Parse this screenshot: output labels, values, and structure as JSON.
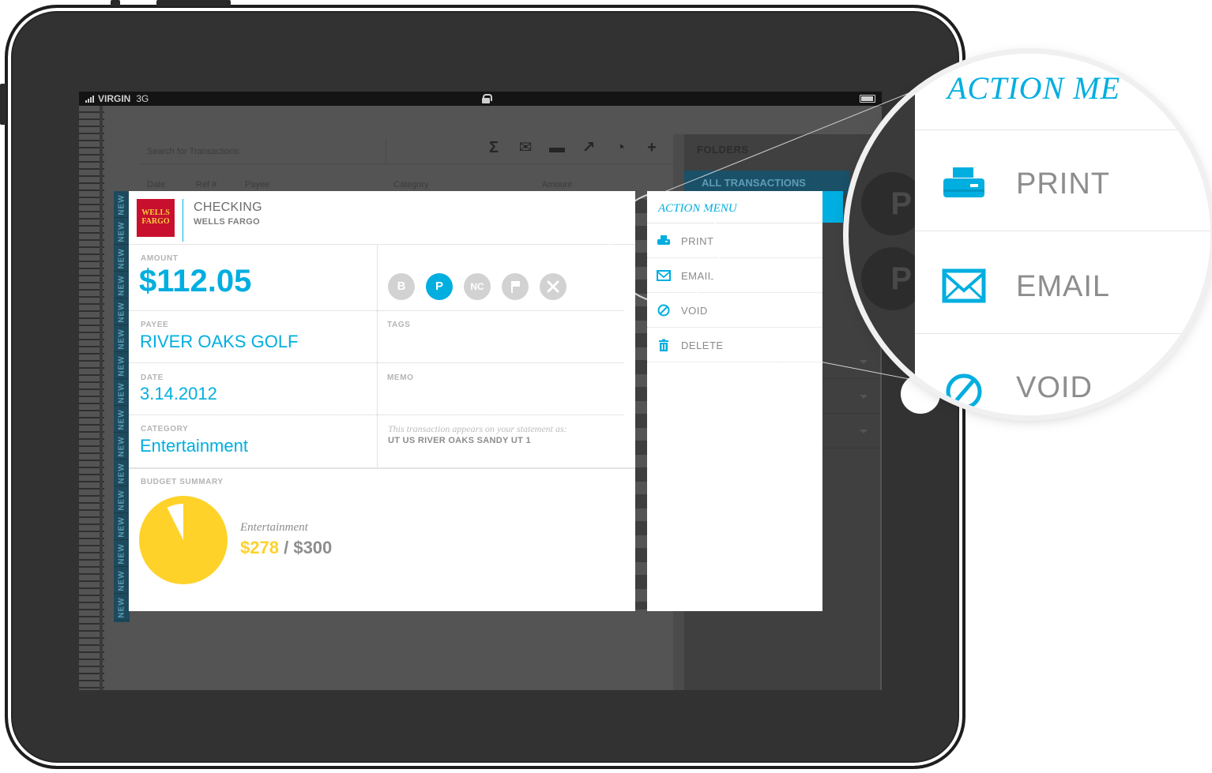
{
  "statusbar": {
    "carrier": "VIRGIN",
    "network": "3G"
  },
  "toolbar": {
    "search_placeholder": "Search for Transactions:",
    "columns": [
      "Date",
      "Ref #",
      "Payee",
      "Category",
      "Amount"
    ],
    "icons": [
      "sigma-icon",
      "envelope-icon",
      "printer-icon",
      "share-icon",
      "pie-chart-icon",
      "plus-icon"
    ]
  },
  "side_tag": "NEW",
  "right_panel": {
    "folders_label": "FOLDERS",
    "all_transactions_label": "ALL TRANSACTIONS"
  },
  "account": {
    "bank_logo_text": "WELLS FARGO",
    "title": "CHECKING",
    "subtitle": "WELLS FARGO"
  },
  "transaction": {
    "amount_label": "AMOUNT",
    "amount": "$112.05",
    "payee_label": "PAYEE",
    "payee": "RIVER OAKS GOLF",
    "date_label": "DATE",
    "date": "3.14.2012",
    "category_label": "CATEGORY",
    "category": "Entertainment",
    "tags_label": "TAGS",
    "memo_label": "MEMO",
    "statement_note": "This transaction appears on your statement as:",
    "statement_value": "UT US RIVER OAKS SANDY UT 1",
    "status_buttons": [
      {
        "label": "B",
        "active": false
      },
      {
        "label": "P",
        "active": true
      },
      {
        "label": "NC",
        "active": false
      },
      {
        "label": "",
        "icon": "flag-icon",
        "active": false
      },
      {
        "label": "",
        "icon": "close-icon",
        "active": false
      }
    ]
  },
  "budget": {
    "label": "BUDGET SUMMARY",
    "category": "Entertainment",
    "spent": "$278",
    "separator": "/",
    "total": "$300",
    "spent_value": 278,
    "total_value": 300
  },
  "action_menu": {
    "title": "ACTION MENU",
    "items": [
      {
        "label": "PRINT",
        "icon": "printer-icon"
      },
      {
        "label": "EMAIL",
        "icon": "envelope-icon"
      },
      {
        "label": "VOID",
        "icon": "void-icon"
      },
      {
        "label": "DELETE",
        "icon": "trash-icon"
      }
    ]
  },
  "zoom": {
    "title": "ACTION ME",
    "items": [
      "PRINT",
      "EMAIL",
      "VOID"
    ],
    "side_letter": "P"
  },
  "colors": {
    "accent": "#00aee0",
    "budget_spent": "#ffd22a",
    "bank_red": "#c8102e",
    "bank_gold": "#f7cd3c"
  }
}
